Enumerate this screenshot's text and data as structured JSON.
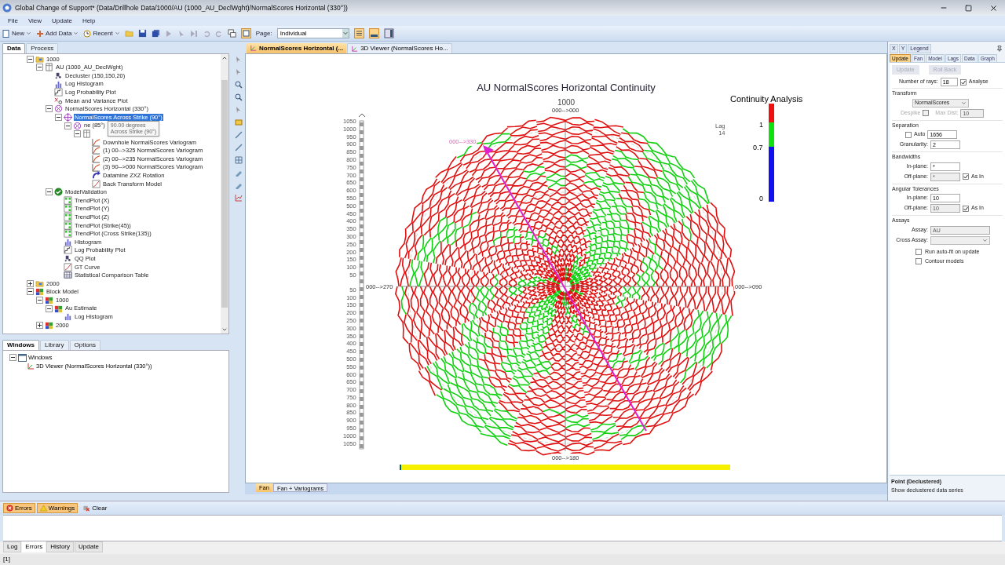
{
  "window": {
    "title": "Global Change of Support* (Data/Drillhole Data/1000/AU (1000_AU_DeclWght)/NormalScores Horizontal (330°))"
  },
  "menu": [
    "File",
    "View",
    "Update",
    "Help"
  ],
  "toolbar": {
    "buttons": [
      {
        "label": "New",
        "kind": "new"
      },
      {
        "label": "Add Data",
        "kind": "add"
      },
      {
        "label": "Recent",
        "kind": "recent"
      }
    ],
    "page_label": "Page:",
    "page_value": "Individual"
  },
  "left_tabs": [
    {
      "label": "Data",
      "selected": true
    },
    {
      "label": "Process",
      "selected": false
    }
  ],
  "tree": [
    {
      "label": "1000",
      "kind": "folder",
      "expanded": true,
      "selected": false,
      "children": [
        {
          "label": "AU (1000_AU_DeclWght)",
          "kind": "table",
          "expanded": true,
          "selected": false,
          "children": [
            {
              "label": "Decluster (150,150,20)",
              "kind": "scatter",
              "selected": false
            },
            {
              "label": "Log Histogram",
              "kind": "histogram",
              "selected": false
            },
            {
              "label": "Log Probability Plot",
              "kind": "probability",
              "selected": false
            },
            {
              "label": "Mean and Variance Plot",
              "kind": "meanvar",
              "selected": false
            },
            {
              "label": "NormalScores Horizontal (330°)",
              "kind": "variomap",
              "expanded": true,
              "selected": false,
              "children": [
                {
                  "label": "NormalScores Across Strike (90°)",
                  "kind": "crosshair",
                  "expanded": true,
                  "selected": true,
                  "children": [
                    {
                      "label": "ne (85°)",
                      "kind": "variomap",
                      "expanded": true,
                      "selected": false,
                      "children": [
                        {
                          "kind": "table",
                          "expanded": true,
                          "children": [
                            {
                              "label": "Downhole NormalScores Variogram",
                              "kind": "variogram",
                              "selected": false
                            },
                            {
                              "label": "(1) 00-->325 NormalScores Variogram",
                              "kind": "variogram",
                              "selected": false
                            },
                            {
                              "label": "(2) 00-->235 NormalScores Variogram",
                              "kind": "variogram",
                              "selected": false
                            },
                            {
                              "label": "(3) 90-->000 NormalScores Variogram",
                              "kind": "variogram",
                              "selected": false
                            },
                            {
                              "label": "Datamine ZXZ Rotation",
                              "kind": "rotation",
                              "selected": false
                            },
                            {
                              "label": "Back Transform Model",
                              "kind": "transform",
                              "selected": false
                            }
                          ]
                        }
                      ]
                    }
                  ]
                }
              ]
            },
            {
              "label": "ModelValidation",
              "kind": "check",
              "expanded": true,
              "selected": false,
              "children": [
                {
                  "label": "TrendPlot (X)",
                  "kind": "trend",
                  "selected": false
                },
                {
                  "label": "TrendPlot (Y)",
                  "kind": "trend",
                  "selected": false
                },
                {
                  "label": "TrendPlot (Z)",
                  "kind": "trend",
                  "selected": false
                },
                {
                  "label": "TrendPlot (Strike(45))",
                  "kind": "trend",
                  "selected": false
                },
                {
                  "label": "TrendPlot (Cross Strike(135))",
                  "kind": "trend",
                  "selected": false
                },
                {
                  "label": "Histogram",
                  "kind": "histogram",
                  "selected": false
                },
                {
                  "label": "Log Probability Plot",
                  "kind": "probability",
                  "selected": false
                },
                {
                  "label": "QQ Plot",
                  "kind": "scatter",
                  "selected": false
                },
                {
                  "label": "GT Curve",
                  "kind": "transform",
                  "selected": false
                },
                {
                  "label": "Statistical Comparison Table",
                  "kind": "grid",
                  "selected": false
                }
              ]
            }
          ]
        }
      ]
    },
    {
      "label": "2000",
      "kind": "folder",
      "expanded": false,
      "selected": false
    },
    {
      "label": "Block Model",
      "kind": "block",
      "expanded": true,
      "selected": false,
      "children": [
        {
          "label": "1000",
          "kind": "block",
          "expanded": true,
          "selected": false,
          "children": [
            {
              "label": "Au Estimate",
              "kind": "block",
              "expanded": true,
              "selected": false,
              "children": [
                {
                  "label": "Log Histogram",
                  "kind": "histogram",
                  "selected": false
                }
              ]
            }
          ]
        },
        {
          "label": "2000",
          "kind": "block",
          "expanded": false,
          "selected": false
        }
      ]
    }
  ],
  "tooltip": [
    "90.00 degrees",
    "Across Strike (90°)"
  ],
  "bottom_left_tabs": [
    {
      "label": "Windows",
      "selected": true
    },
    {
      "label": "Library",
      "selected": false
    },
    {
      "label": "Options",
      "selected": false
    }
  ],
  "windows_tree": {
    "label": "Windows",
    "expanded": true,
    "children": [
      "3D Viewer (NormalScores Horizontal (330°))"
    ]
  },
  "doc_tabs": [
    {
      "label": "NormalScores  Horizontal (...",
      "selected": true
    },
    {
      "label": "3D Viewer (NormalScores Ho...",
      "selected": false
    }
  ],
  "chart": {
    "title": "AU NormalScores Horizontal Continuity",
    "subtitle": "1000",
    "directions": [
      "000-->000",
      "000-->090",
      "000-->180",
      "000-->270"
    ],
    "highlight_direction": "000-->330",
    "lag_label": "Lag",
    "lag_value": "14",
    "legend": {
      "title": "Continuity Analysis",
      "labels": [
        "1",
        "0.7",
        "0"
      ]
    },
    "scale_upper": [
      "1050",
      "1000",
      "950",
      "900",
      "850",
      "800",
      "750",
      "700",
      "650",
      "600",
      "550",
      "500",
      "450",
      "400",
      "350",
      "300",
      "250",
      "200",
      "150",
      "100",
      "50"
    ],
    "scale_lower": [
      "50",
      "100",
      "150",
      "200",
      "250",
      "300",
      "350",
      "400",
      "450",
      "500",
      "550",
      "600",
      "650",
      "700",
      "750",
      "800",
      "850",
      "900",
      "950",
      "1000",
      "1050"
    ]
  },
  "chart_tabs": [
    {
      "label": "Fan",
      "selected": true
    },
    {
      "label": "Fan + Variograms",
      "selected": false
    }
  ],
  "right_panel": {
    "top_tabs": [
      "X",
      "Y",
      "Legend"
    ],
    "tabs": [
      {
        "label": "Update",
        "selected": true
      },
      {
        "label": "Fan",
        "selected": false
      },
      {
        "label": "Model",
        "selected": false
      },
      {
        "label": "Lags",
        "selected": false
      },
      {
        "label": "Data",
        "selected": false
      },
      {
        "label": "Graph",
        "selected": false
      }
    ],
    "buttons": [
      {
        "label": "Update",
        "disabled": true
      },
      {
        "label": "Roll Back",
        "disabled": true
      }
    ],
    "rays": {
      "label": "Number of rays:",
      "value": "18"
    },
    "analyse": {
      "label": "Analyse",
      "checked": true
    },
    "groups": [
      {
        "title": "Transform",
        "rows": [
          {
            "kind": "select",
            "value": "NormalScores"
          },
          {
            "kind": "despike",
            "label": "Despike",
            "checked": false,
            "field_label": "Max Dist:",
            "value": "10"
          }
        ]
      },
      {
        "title": "Separation",
        "rows": [
          {
            "kind": "check-field",
            "label": "Auto",
            "checked": false,
            "value": "1656"
          },
          {
            "kind": "field",
            "label": "Granularity:",
            "value": "2",
            "disabled": false
          }
        ]
      },
      {
        "title": "Bandwidths",
        "rows": [
          {
            "kind": "field",
            "label": "In-plane:",
            "value": "*",
            "disabled": false
          },
          {
            "kind": "field",
            "label": "Off-plane:",
            "value": "*",
            "disabled": true,
            "as_in": {
              "label": "As In",
              "checked": true
            }
          }
        ]
      },
      {
        "title": "Angular Tolerances",
        "rows": [
          {
            "kind": "field",
            "label": "In-plane:",
            "value": "10",
            "disabled": false
          },
          {
            "kind": "field",
            "label": "Off-plane:",
            "value": "10",
            "disabled": true,
            "as_in": {
              "label": "As In",
              "checked": true
            }
          }
        ]
      },
      {
        "title": "Assays",
        "rows": [
          {
            "kind": "wide-field",
            "label": "Assay:",
            "value": "AU"
          },
          {
            "kind": "wide-select",
            "label": "Cross Assay:"
          }
        ]
      }
    ],
    "options": [
      {
        "label": "Run auto-fit on update",
        "checked": false
      },
      {
        "label": "Contour models",
        "checked": false
      }
    ],
    "info": {
      "title": "Point (Declustered)",
      "text": "Show declustered data series"
    }
  },
  "message_bar": [
    {
      "label": "Errors",
      "kind": "error",
      "on": true
    },
    {
      "label": "Warnings",
      "kind": "warning",
      "on": true
    },
    {
      "label": "Clear",
      "kind": "clear",
      "on": false
    }
  ],
  "log_tabs": [
    {
      "label": "Log",
      "selected": false
    },
    {
      "label": "Errors",
      "selected": true
    },
    {
      "label": "History",
      "selected": false
    },
    {
      "label": "Update",
      "selected": false
    }
  ],
  "status_bar": "[1]"
}
